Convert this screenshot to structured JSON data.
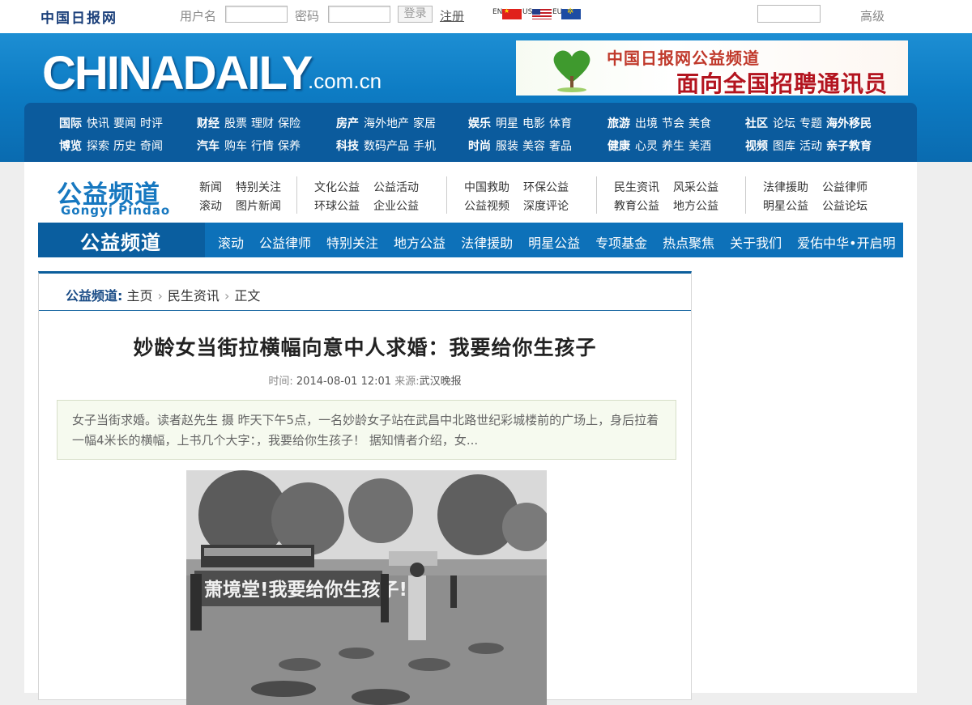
{
  "topbar": {
    "logo": "中国日报网",
    "username_label": "用户名",
    "username_value": "",
    "password_label": "密码",
    "password_value": "",
    "login_label": "登录",
    "register_label": "注册",
    "langs": [
      "EN",
      "US",
      "EU"
    ],
    "search_value": "",
    "advanced_label": "高级"
  },
  "header": {
    "brand": "CHINADAILY",
    "brand_domain": ".com.cn",
    "banner_line1": "中国日报网公益频道",
    "banner_line2": "面向全国招聘通讯员"
  },
  "nav": {
    "groups": [
      {
        "row1": [
          "国际",
          "快讯",
          "要闻",
          "时评"
        ],
        "row2": [
          "博览",
          "探索",
          "历史",
          "奇闻"
        ]
      },
      {
        "row1": [
          "财经",
          "股票",
          "理财",
          "保险"
        ],
        "row2": [
          "汽车",
          "购车",
          "行情",
          "保养"
        ]
      },
      {
        "row1": [
          "房产",
          "海外地产",
          "家居"
        ],
        "row2": [
          "科技",
          "数码产品",
          "手机"
        ]
      },
      {
        "row1": [
          "娱乐",
          "明星",
          "电影",
          "体育"
        ],
        "row2": [
          "时尚",
          "服装",
          "美容",
          "奢品"
        ]
      },
      {
        "row1": [
          "旅游",
          "出境",
          "节会",
          "美食"
        ],
        "row2": [
          "健康",
          "心灵",
          "养生",
          "美酒"
        ]
      },
      {
        "row1": [
          "社区",
          "论坛",
          "专题",
          "海外移民"
        ],
        "row2": [
          "视频",
          "图库",
          "活动",
          "亲子教育"
        ]
      }
    ]
  },
  "channel": {
    "logo": "公益频道",
    "logo_pinyin": "Gongyi Pindao",
    "sublinks": [
      {
        "row1": [
          "新闻",
          "特别关注"
        ],
        "row2": [
          "滚动",
          "图片新闻"
        ]
      },
      {
        "row1": [
          "文化公益",
          "公益活动"
        ],
        "row2": [
          "环球公益",
          "企业公益"
        ]
      },
      {
        "row1": [
          "中国救助",
          "环保公益"
        ],
        "row2": [
          "公益视频",
          "深度评论"
        ]
      },
      {
        "row1": [
          "民生资讯",
          "风采公益"
        ],
        "row2": [
          "教育公益",
          "地方公益"
        ]
      },
      {
        "row1": [
          "法律援助",
          "公益律师"
        ],
        "row2": [
          "明星公益",
          "公益论坛"
        ]
      }
    ],
    "bar_title": "公益频道",
    "bar_items": [
      "滚动",
      "公益律师",
      "特别关注",
      "地方公益",
      "法律援助",
      "明星公益",
      "专项基金",
      "热点聚焦",
      "关于我们",
      "爱佑中华•开启明"
    ]
  },
  "article": {
    "breadcrumb_root": "公益频道:",
    "breadcrumb": [
      "主页",
      "民生资讯",
      "正文"
    ],
    "title": "妙龄女当街拉横幅向意中人求婚：我要给你生孩子",
    "time_label": "时间:",
    "time_value": "2014-08-01 12:01",
    "source_label": "来源:",
    "source_value": "武汉晚报",
    "summary": "女子当街求婚。读者赵先生 摄 昨天下午5点，一名妙龄女子站在武昌中北路世纪彩城楼前的广场上，身后拉着一幅4米长的横幅，上书几个大字：，我要给你生孩子！ 据知情者介绍，女...",
    "photo_banner_text": "萧境堂!我要给你生孩子!"
  }
}
